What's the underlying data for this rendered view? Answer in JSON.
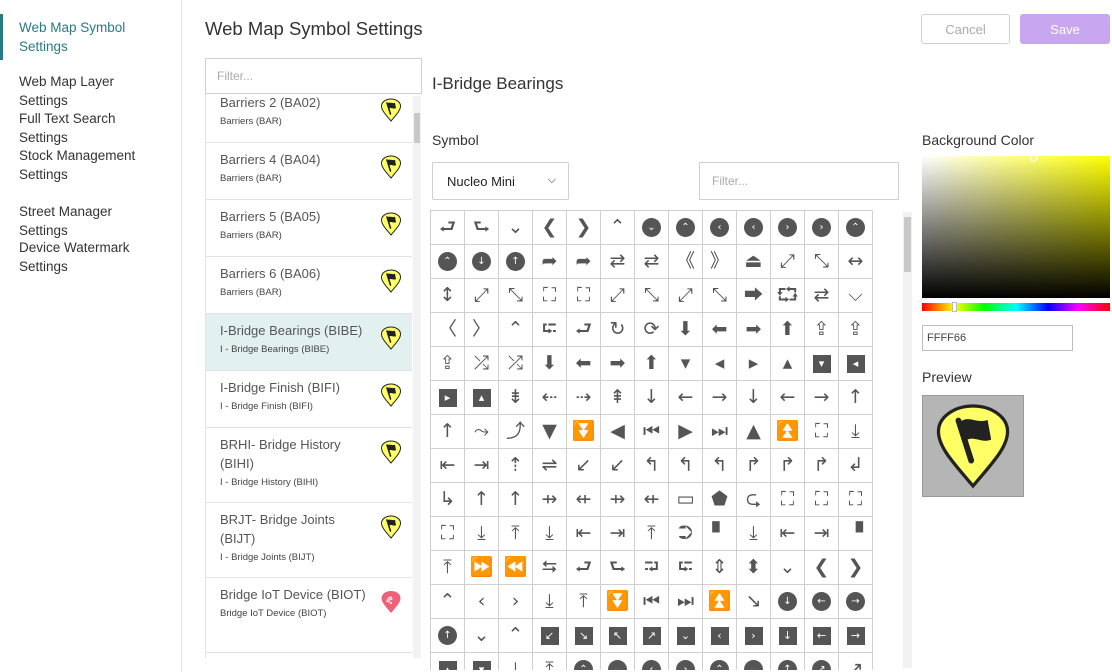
{
  "nav": {
    "items": [
      {
        "label": "Web Map Symbol Settings",
        "active": true
      },
      {
        "label": "Web Map Layer Settings",
        "active": false
      },
      {
        "label": "Full Text Search Settings",
        "active": false
      },
      {
        "label": "Stock Management Settings",
        "active": false
      },
      {
        "label": "Street Manager Settings",
        "active": false
      },
      {
        "label": "Device Watermark Settings",
        "active": false
      }
    ]
  },
  "header": {
    "title": "Web Map Symbol Settings",
    "cancel_label": "Cancel",
    "save_label": "Save"
  },
  "list": {
    "filter_placeholder": "Filter...",
    "items": [
      {
        "name": "Barriers 2 (BA02)",
        "sub": "Barriers (BAR)",
        "icon": "flag-marker-yellow"
      },
      {
        "name": "Barriers 4 (BA04)",
        "sub": "Barriers (BAR)",
        "icon": "flag-marker-yellow"
      },
      {
        "name": "Barriers 5 (BA05)",
        "sub": "Barriers (BAR)",
        "icon": "flag-marker-yellow"
      },
      {
        "name": "Barriers 6 (BA06)",
        "sub": "Barriers (BAR)",
        "icon": "flag-marker-yellow"
      },
      {
        "name": "I-Bridge Bearings (BIBE)",
        "sub": "I - Bridge Bearings (BIBE)",
        "icon": "flag-marker-yellow",
        "selected": true
      },
      {
        "name": "I-Bridge Finish (BIFI)",
        "sub": "I - Bridge Finish (BIFI)",
        "icon": "flag-marker-yellow"
      },
      {
        "name": "BRHI- Bridge History (BIHI)",
        "sub": "I - Bridge History (BIHI)",
        "icon": "flag-marker-yellow"
      },
      {
        "name": "BRJT- Bridge Joints (BIJT)",
        "sub": "I - Bridge Joints (BIJT)",
        "icon": "flag-marker-yellow"
      },
      {
        "name": "Bridge IoT Device (BIOT)",
        "sub": "Bridge IoT Device (BIOT)",
        "icon": "wifi-marker-pink"
      }
    ]
  },
  "detail": {
    "title": "I-Bridge Bearings",
    "symbol_label": "Symbol",
    "icon_set": "Nucleo Mini",
    "icon_filter_placeholder": "Filter...",
    "background_label": "Background Color",
    "hex_value": "FFFF66",
    "preview_label": "Preview"
  },
  "colors": {
    "accent": "#2a7a86",
    "save_bg": "#c9a6f0",
    "symbol_fill": "#ffff66",
    "iot_marker": "#f0607a"
  },
  "icon_grid": {
    "columns": 13,
    "cells": [
      "⮐",
      "⮑",
      "⌄",
      "❮",
      "❯",
      "⌃",
      "◉⌄",
      "◉⌃",
      "◉‹",
      "◉‹",
      "◉›",
      "◉›",
      "◉⌃",
      "◉⌃",
      "◉↓",
      "◉↑",
      "➦",
      "➦",
      "⇄",
      "⇄",
      "《",
      "》",
      "⏏",
      "⤢",
      "⤡",
      "↔",
      "↕",
      "⤢",
      "⤡",
      "⛶",
      "⛶",
      "⤢",
      "⤡",
      "⤢",
      "⤡",
      "⮕",
      "⮔",
      "⇄",
      "⌵",
      "〈",
      "〉",
      "⌃",
      "⮓",
      "⮐",
      "↻",
      "⟳",
      "⬇",
      "⬅",
      "➡",
      "⬆",
      "⇪",
      "⇪",
      "⇪",
      "⤮",
      "⤮",
      "⬇",
      "⬅",
      "➡",
      "⬆",
      "▾",
      "◂",
      "▸",
      "▴",
      "■▾",
      "■◂",
      "■▸",
      "■▴",
      "⇟",
      "⇠",
      "⇢",
      "⇞",
      "↓",
      "←",
      "→",
      "↓",
      "←",
      "→",
      "↑",
      "↑",
      "⤳",
      "⤴",
      "▼",
      "⏬",
      "◀",
      "⏮",
      "▶",
      "⏭",
      "▲",
      "⏫",
      "⛶",
      "⤓",
      "⇤",
      "⇥",
      "⇡",
      "⇌",
      "↙",
      "↙",
      "↰",
      "↰",
      "↰",
      "↱",
      "↱",
      "↱",
      "↲",
      "↳",
      "↑",
      "↑",
      "⇸",
      "⇷",
      "⇸",
      "⇷",
      "▭",
      "⬟",
      "⮎",
      "⛶",
      "⛶",
      "⛶",
      "⛶",
      "⤓",
      "⤒",
      "⤓",
      "⇤",
      "⇥",
      "⤒",
      "⮊",
      "▘",
      "⤓",
      "⇤",
      "⇥",
      "▝",
      "⤒",
      "⏩",
      "⏪",
      "⮀",
      "⮐",
      "⮑",
      "⮒",
      "⮓",
      "⇕",
      "⬍",
      "⌄",
      "❮",
      "❯",
      "⌃",
      "‹",
      "›",
      "⤓",
      "⤒",
      "⏬",
      "⏮",
      "⏭",
      "⏫",
      "↘",
      "◉↓",
      "◉←",
      "◉→",
      "◉↑",
      "⌄",
      "⌃",
      "■↙",
      "■↘",
      "■↖",
      "■↗",
      "■⌄",
      "■‹",
      "■›",
      "■↓",
      "■←",
      "■→",
      "■▴",
      "■▾",
      "⤓",
      "⤒",
      "◉⌃",
      "◉⌄",
      "◉‹",
      "◉›",
      "◉⌃",
      "◉⌄",
      "◉↑",
      "◉↗",
      "↗"
    ]
  }
}
